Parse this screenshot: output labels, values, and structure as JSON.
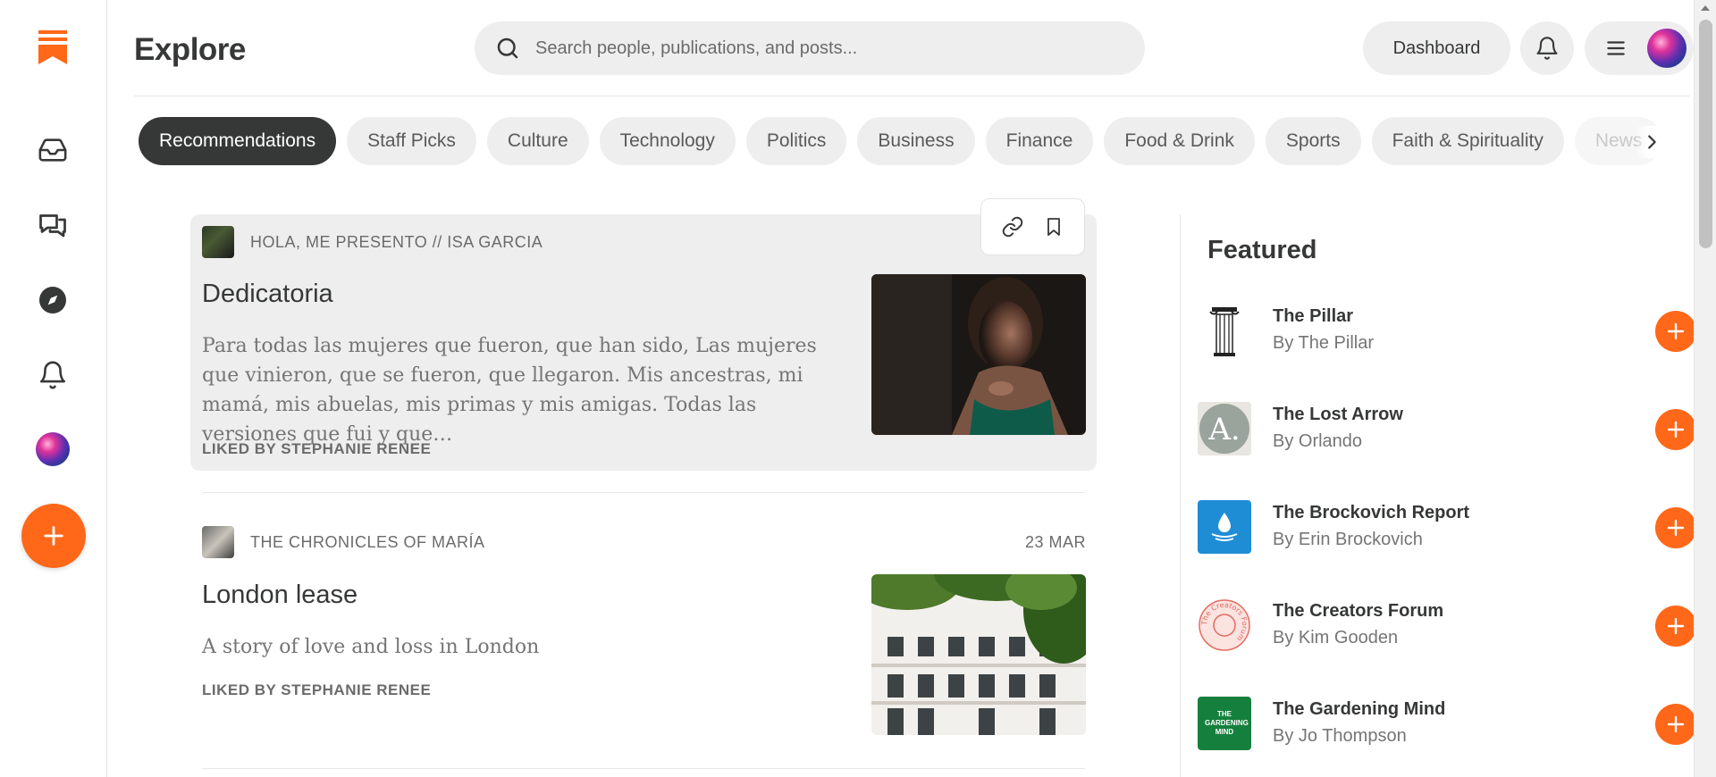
{
  "app": {
    "page_title": "Explore"
  },
  "search": {
    "placeholder": "Search people, publications, and posts..."
  },
  "header": {
    "dashboard_label": "Dashboard"
  },
  "rail": {
    "items": [
      {
        "icon": "inbox-icon"
      },
      {
        "icon": "chat-icon"
      },
      {
        "icon": "compass-icon"
      },
      {
        "icon": "bell-icon"
      }
    ]
  },
  "categories": [
    {
      "label": "Recommendations",
      "active": true
    },
    {
      "label": "Staff Picks"
    },
    {
      "label": "Culture"
    },
    {
      "label": "Technology"
    },
    {
      "label": "Politics"
    },
    {
      "label": "Business"
    },
    {
      "label": "Finance"
    },
    {
      "label": "Food & Drink"
    },
    {
      "label": "Sports"
    },
    {
      "label": "Faith & Spirituality"
    },
    {
      "label": "News"
    }
  ],
  "posts": [
    {
      "publication": "HOLA, ME PRESENTO // ISA GARCIA",
      "date": "",
      "title": "Dedicatoria",
      "excerpt": "Para todas las mujeres que fueron, que han sido, Las mujeres que vinieron, que se fueron, que llegaron. Mis ancestras, mi mamá, mis abuelas, mis primas y mis amigas. Todas las versiones que fui y que…",
      "liked_by": "LIKED BY STEPHANIE RENEE"
    },
    {
      "publication": "THE CHRONICLES OF MARÍA",
      "date": "23 MAR",
      "title": "London lease",
      "excerpt": "A story of love and loss in London",
      "liked_by": "LIKED BY STEPHANIE RENEE"
    }
  ],
  "featured": {
    "title": "Featured",
    "items": [
      {
        "name": "The Pillar",
        "author": "By The Pillar"
      },
      {
        "name": "The Lost Arrow",
        "author": "By Orlando"
      },
      {
        "name": "The Brockovich Report",
        "author": "By Erin Brockovich"
      },
      {
        "name": "The Creators Forum",
        "author": "By Kim Gooden"
      },
      {
        "name": "The Gardening Mind",
        "author": "By Jo Thompson"
      }
    ],
    "logo_texts": {
      "lost_arrow": "A.",
      "creators_forum": "The Creators Forum",
      "gardening_mind": "THE GARDENING MIND"
    }
  },
  "colors": {
    "accent": "#ff6719",
    "text": "#363737",
    "pill_bg": "#eeeeee"
  }
}
